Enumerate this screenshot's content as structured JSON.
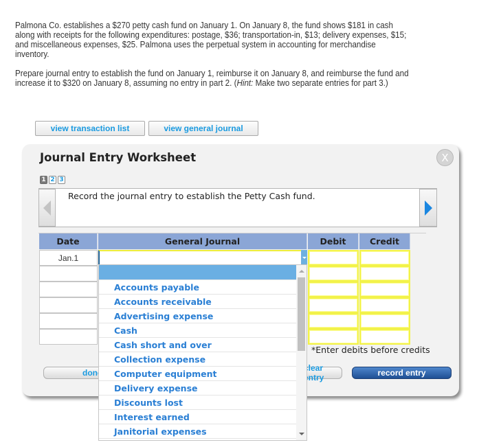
{
  "problem": {
    "paragraph1": "Palmona Co. establishes a $270 petty cash fund on January 1. On January 8, the fund shows $181 in cash along with receipts for the following expenditures: postage, $36; transportation-in, $13; delivery expenses, $15; and miscellaneous expenses, $25. Palmona uses the perpetual system in accounting for merchandise inventory.",
    "paragraph2_main": "Prepare journal entry to establish the fund on January 1, reimburse it on January 8, and  reimburse the fund and increase it to $320 on January 8, assuming no entry in part 2. (",
    "paragraph2_hint_label": "Hint:",
    "paragraph2_hint_text": " Make two separate entries for part 3.)"
  },
  "toolbar": {
    "view_transaction_list": "view transaction list",
    "view_general_journal": "view general journal"
  },
  "worksheet": {
    "title": "Journal Entry Worksheet",
    "close_label": "X",
    "pages": [
      "1",
      "2",
      "3"
    ],
    "active_page": 1,
    "instruction": "Record the journal entry to establish the Petty Cash fund.",
    "columns": {
      "date": "Date",
      "general_journal": "General Journal",
      "debit": "Debit",
      "credit": "Credit"
    },
    "rows": [
      {
        "date": "Jan.1",
        "account": "",
        "debit": "",
        "credit": ""
      },
      {
        "date": "",
        "account": "",
        "debit": "",
        "credit": ""
      },
      {
        "date": "",
        "account": "",
        "debit": "",
        "credit": ""
      },
      {
        "date": "",
        "account": "",
        "debit": "",
        "credit": ""
      },
      {
        "date": "",
        "account": "",
        "debit": "",
        "credit": ""
      },
      {
        "date": "",
        "account": "",
        "debit": "",
        "credit": ""
      }
    ],
    "note": "*Enter debits before credits",
    "buttons": {
      "done": "done",
      "clear_entry": "clear entry",
      "record_entry": "record entry"
    }
  },
  "dropdown": {
    "selected": "",
    "options": [
      "",
      "Accounts payable",
      "Accounts receivable",
      "Advertising expense",
      "Cash",
      "Cash short and over",
      "Collection expense",
      "Computer equipment",
      "Delivery expense",
      "Discounts lost",
      "Interest earned",
      "Janitorial expenses"
    ]
  },
  "colors": {
    "accent_blue": "#1a9ae0",
    "header_blue": "#8ba6d6",
    "record_button": "#1e4f94",
    "input_border_yellow": "#f2f24a"
  }
}
